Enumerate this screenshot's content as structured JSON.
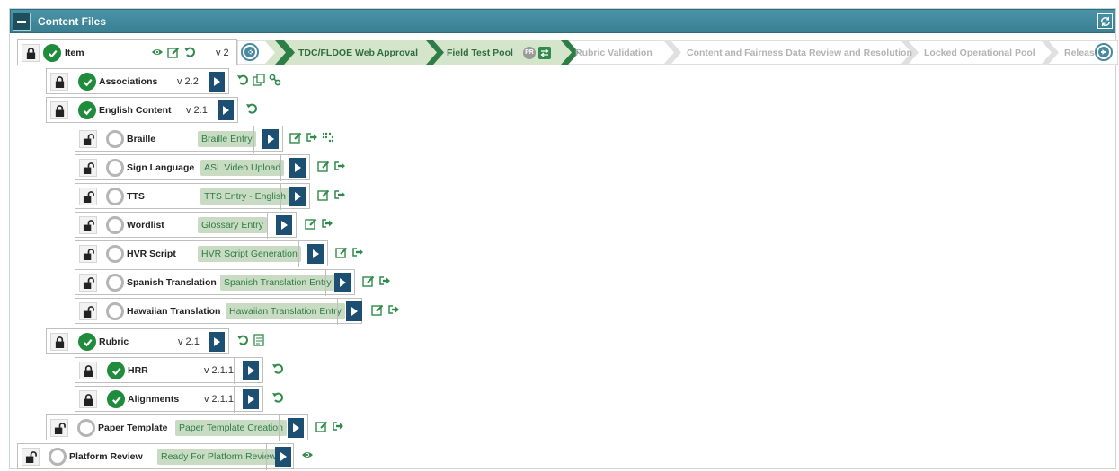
{
  "panel": {
    "title": "Content Files"
  },
  "item": {
    "label": "Item",
    "version": "v 2"
  },
  "pipeline": [
    {
      "label": "TDC/FLDOE Web Approval",
      "state": "done"
    },
    {
      "label": "Field Test Pool",
      "state": "current"
    },
    {
      "label": "Rubric Validation",
      "state": "future"
    },
    {
      "label": "Content and Fairness Data Review and Resolution",
      "state": "future"
    },
    {
      "label": "Locked Operational Pool",
      "state": "future"
    },
    {
      "label": "Released",
      "state": "future"
    }
  ],
  "pr_badge": "PR",
  "rows": {
    "associations": {
      "label": "Associations",
      "version": "v 2.2"
    },
    "english": {
      "label": "English Content",
      "version": "v 2.1"
    },
    "braille": {
      "label": "Braille",
      "tag": "Braille Entry"
    },
    "sign": {
      "label": "Sign Language",
      "tag": "ASL Video Upload"
    },
    "tts": {
      "label": "TTS",
      "tag": "TTS Entry - English"
    },
    "wordlist": {
      "label": "Wordlist",
      "tag": "Glossary Entry"
    },
    "hvr": {
      "label": "HVR Script",
      "tag": "HVR Script Generation"
    },
    "spanish": {
      "label": "Spanish Translation",
      "tag": "Spanish Translation Entry"
    },
    "hawaiian": {
      "label": "Hawaiian Translation",
      "tag": "Hawaiian Translation Entry"
    },
    "rubric": {
      "label": "Rubric",
      "version": "v 2.1"
    },
    "hrr": {
      "label": "HRR",
      "version": "v 2.1.1"
    },
    "alignments": {
      "label": "Alignments",
      "version": "v 2.1.1"
    },
    "paper": {
      "label": "Paper Template",
      "tag": "Paper Template Creation"
    },
    "platform": {
      "label": "Platform Review",
      "tag": "Ready For Platform Review"
    }
  },
  "colors": {
    "header": "#3f8699",
    "done": "#1e8c3a",
    "go_button": "#1d4f73",
    "tag_bg": "#c9dcc3",
    "stage_active": "#2e6e3e"
  }
}
